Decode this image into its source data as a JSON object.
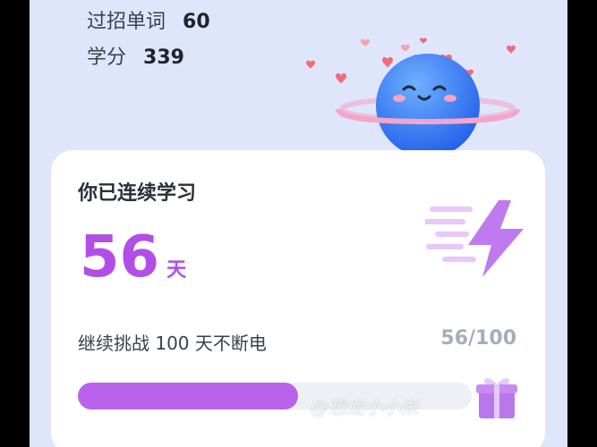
{
  "stats": {
    "words_label": "过招单词",
    "words_value": "60",
    "score_label": "学分",
    "score_value": "339"
  },
  "card": {
    "title": "你已连续学习",
    "streak_days": "56",
    "streak_unit": "天",
    "challenge_text": "继续挑战 100 天不断电",
    "progress_text": "56/100",
    "progress": 0.56
  },
  "watermark": "@恐龙小小米",
  "colors": {
    "accent": "#b24ee6",
    "progress_fill": "#ba62ec",
    "mascot": "#3b82f6",
    "background": "#dfe6fb"
  },
  "icons": {
    "mascot": "planet-mascot-icon",
    "bolt": "lightning-bolt-icon",
    "gift": "gift-box-icon"
  }
}
